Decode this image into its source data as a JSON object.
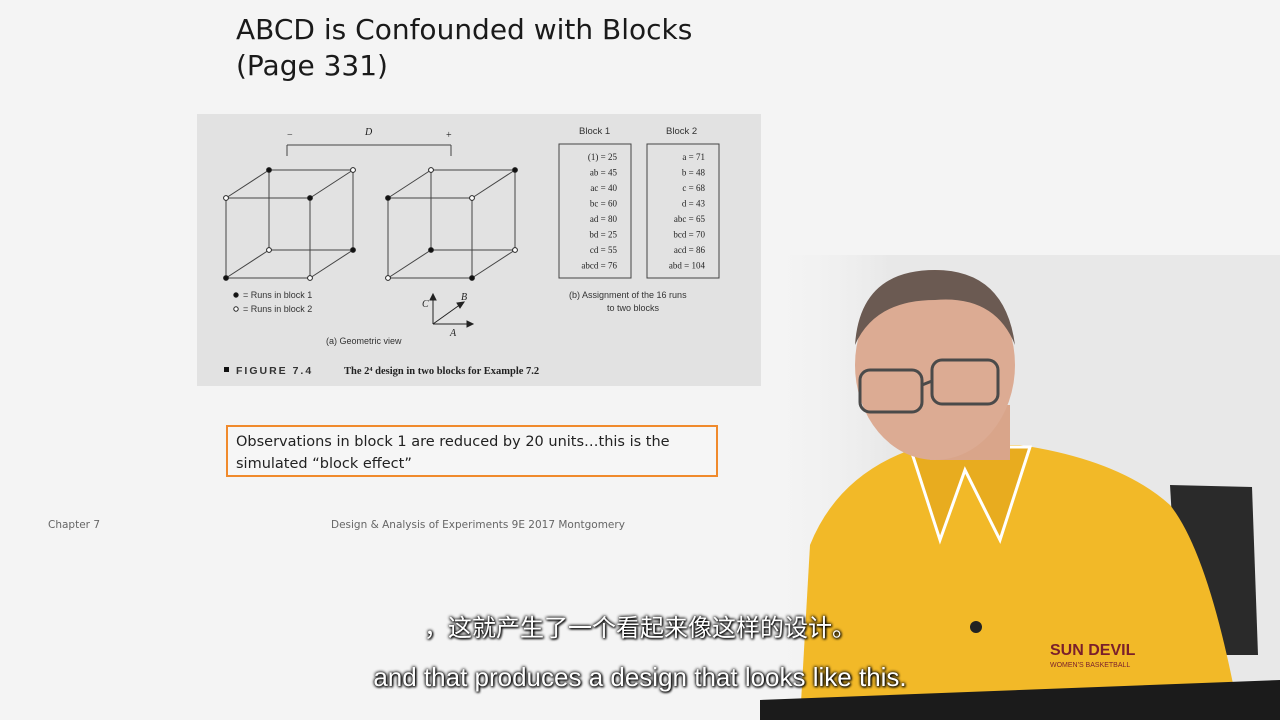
{
  "slide": {
    "title_line1": "ABCD is Confounded with Blocks",
    "title_line2": "(Page 331)"
  },
  "figure": {
    "d_label": "D",
    "minus_label": "−",
    "plus_label": "+",
    "legend_block1": "= Runs in block 1",
    "legend_block2": "= Runs in block 2",
    "axis_a": "A",
    "axis_b": "B",
    "axis_c": "C",
    "geometric_view_caption": "(a) Geometric view",
    "block1_header": "Block 1",
    "block2_header": "Block 2",
    "block1_runs": [
      "(1) = 25",
      "ab = 45",
      "ac = 40",
      "bc = 60",
      "ad = 80",
      "bd = 25",
      "cd = 55",
      "abcd = 76"
    ],
    "block2_runs": [
      "a = 71",
      "b = 48",
      "c = 68",
      "d = 43",
      "abc = 65",
      "bcd = 70",
      "acd = 86",
      "abd = 104"
    ],
    "assignment_caption_line1": "(b) Assignment of the 16 runs",
    "assignment_caption_line2": "to two blocks",
    "figure_label": "FIGURE 7.4",
    "figure_caption": "The 2⁴ design in two blocks for Example 7.2"
  },
  "note": {
    "text_line1": "Observations in block 1 are reduced by 20 units…this is the",
    "text_line2": "simulated “block effect”"
  },
  "footer": {
    "chapter": "Chapter 7",
    "book": "Design & Analysis of Experiments 9E 2017 Montgomery"
  },
  "presenter": {
    "shirt_text": "SUN DEVIL",
    "shirt_subtext": "WOMEN'S BASKETBALL"
  },
  "subtitles": {
    "zh": "，这就产生了一个看起来像这样的设计。",
    "en": "and that produces a design that looks like this."
  }
}
